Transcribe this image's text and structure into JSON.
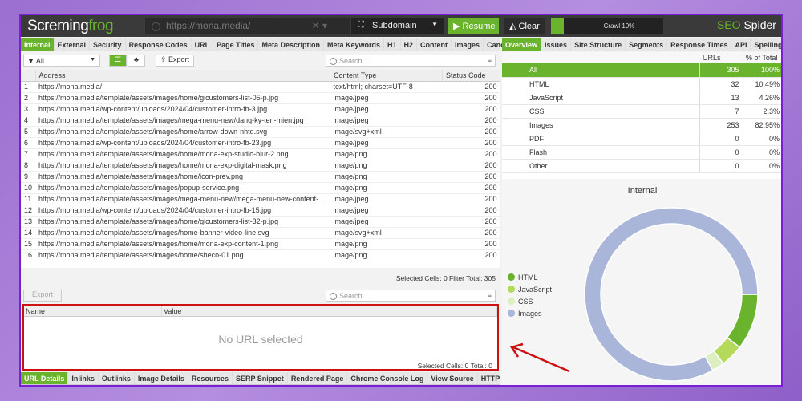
{
  "app": {
    "logo_main": "Scre",
    "logo_mid": "ming",
    "logo_frog": "frog",
    "url": "https://mona.media/",
    "mode": "Subdomain",
    "resume": "Resume",
    "clear": "Clear",
    "crawl_label": "Crawl 10%",
    "crawl_progress": 10,
    "brand_seo": "SEO",
    "brand_spider": "Spider",
    "accent": "#6ab42d"
  },
  "left_tabs": [
    "Internal",
    "External",
    "Security",
    "Response Codes",
    "URL",
    "Page Titles",
    "Meta Description",
    "Meta Keywords",
    "H1",
    "H2",
    "Content",
    "Images",
    "Canonicals"
  ],
  "toolbar": {
    "filter": "All",
    "export": "Export",
    "search_placeholder": "Search..."
  },
  "grid": {
    "columns": [
      "Address",
      "Content Type",
      "Status Code"
    ],
    "rows": [
      [
        "1",
        "https://mona.media/",
        "text/html; charset=UTF-8",
        "200"
      ],
      [
        "2",
        "https://mona.media/template/assets/images/home/gicustomers-list-05-p.jpg",
        "image/jpeg",
        "200"
      ],
      [
        "3",
        "https://mona.media/wp-content/uploads/2024/04/customer-intro-fb-3.jpg",
        "image/jpeg",
        "200"
      ],
      [
        "4",
        "https://mona.media/template/assets/images/mega-menu-new/dang-ky-ten-mien.jpg",
        "image/jpeg",
        "200"
      ],
      [
        "5",
        "https://mona.media/template/assets/images/home/arrow-down-nhtq.svg",
        "image/svg+xml",
        "200"
      ],
      [
        "6",
        "https://mona.media/wp-content/uploads/2024/04/customer-intro-fb-23.jpg",
        "image/jpeg",
        "200"
      ],
      [
        "7",
        "https://mona.media/template/assets/images/home/mona-exp-studio-blur-2.png",
        "image/png",
        "200"
      ],
      [
        "8",
        "https://mona.media/template/assets/images/home/mona-exp-digital-mask.png",
        "image/png",
        "200"
      ],
      [
        "9",
        "https://mona.media/template/assets/images/home/icon-prev.png",
        "image/png",
        "200"
      ],
      [
        "10",
        "https://mona.media/template/assets/images/popup-service.png",
        "image/png",
        "200"
      ],
      [
        "11",
        "https://mona.media/template/assets/images/mega-menu-new/mega-menu-new-content-...",
        "image/jpeg",
        "200"
      ],
      [
        "12",
        "https://mona.media/wp-content/uploads/2024/04/customer-intro-fb-15.jpg",
        "image/jpeg",
        "200"
      ],
      [
        "13",
        "https://mona.media/template/assets/images/home/gicustomers-list-32-p.jpg",
        "image/jpeg",
        "200"
      ],
      [
        "14",
        "https://mona.media/template/assets/images/home-banner-video-line.svg",
        "image/svg+xml",
        "200"
      ],
      [
        "15",
        "https://mona.media/template/assets/images/home/mona-exp-content-1.png",
        "image/png",
        "200"
      ],
      [
        "16",
        "https://mona.media/template/assets/images/home/sheco-01.png",
        "image/png",
        "200"
      ]
    ],
    "status": "Selected Cells:  0  Filter Total:  305"
  },
  "details": {
    "export": "Export",
    "search_placeholder": "Search...",
    "columns": [
      "Name",
      "Value"
    ],
    "empty": "No URL selected",
    "status": "Selected Cells:  0  Total:  0"
  },
  "bottom_tabs": [
    "URL Details",
    "Inlinks",
    "Outlinks",
    "Image Details",
    "Resources",
    "SERP Snippet",
    "Rendered Page",
    "Chrome Console Log",
    "View Source",
    "HTTP Headers"
  ],
  "right_tabs": [
    "Overview",
    "Issues",
    "Site Structure",
    "Segments",
    "Response Times",
    "API",
    "Spelling & Gr"
  ],
  "overview": {
    "columns": [
      "URLs",
      "% of Total"
    ],
    "rows": [
      [
        "All",
        "305",
        "100%"
      ],
      [
        "HTML",
        "32",
        "10.49%"
      ],
      [
        "JavaScript",
        "13",
        "4.26%"
      ],
      [
        "CSS",
        "7",
        "2.3%"
      ],
      [
        "Images",
        "253",
        "82.95%"
      ],
      [
        "PDF",
        "0",
        "0%"
      ],
      [
        "Flash",
        "0",
        "0%"
      ],
      [
        "Other",
        "0",
        "0%"
      ]
    ]
  },
  "chart_data": {
    "type": "pie",
    "title": "Internal",
    "categories": [
      "HTML",
      "JavaScript",
      "CSS",
      "Images"
    ],
    "values": [
      32,
      13,
      7,
      253
    ],
    "colors": [
      "#6ab42d",
      "#b5d95a",
      "#dcefc0",
      "#a9b6da"
    ],
    "legend": "left"
  }
}
